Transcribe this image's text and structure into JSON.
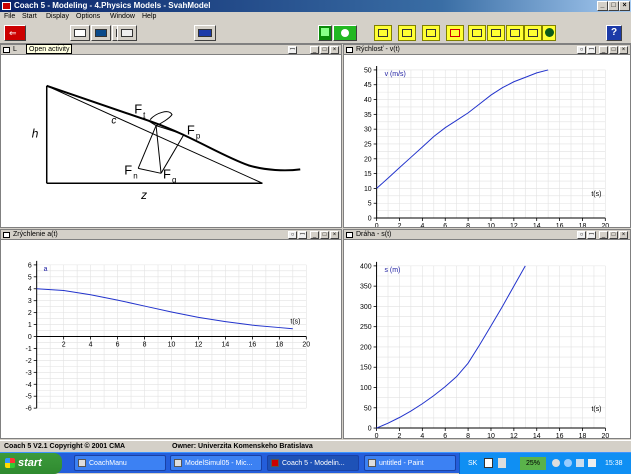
{
  "window": {
    "title": "Coach 5 - Modeling - 4.Physics Models - SvahModel"
  },
  "menu": [
    "File",
    "Start",
    "Display",
    "Options",
    "Window",
    "Help"
  ],
  "tooltip": "Open activity",
  "panels": {
    "diagram": {
      "title": "L",
      "labels": {
        "ft": "F",
        "ft_sub": "t",
        "fp": "F",
        "fp_sub": "p",
        "fn": "F",
        "fn_sub": "n",
        "fg": "F",
        "fg_sub": "g",
        "h": "h",
        "c": "c",
        "z": "z"
      }
    },
    "speed": {
      "title": "Rýchlosť - v(t)"
    },
    "accel": {
      "title": "Zrýchlenie a(t)"
    },
    "path": {
      "title": "Dráha - s(t)"
    }
  },
  "status": {
    "left": "Coach 5 V2.1 Copyright © 2001 CMA",
    "right": "Owner: Univerzita Komenskeho Bratislava"
  },
  "taskbar": {
    "start": "start",
    "tasks": [
      "CoachManu",
      "ModelSimul05 - Mic...",
      "Coach 5 - Modelin...",
      "untitled - Paint"
    ],
    "lang": "SK",
    "percent": "25%",
    "clock": "15:38"
  },
  "chart_data": [
    {
      "type": "line",
      "title": "Rýchlosť - v(t)",
      "ylabel": "v (m/s)",
      "xlabel": "t(s)",
      "xlim": [
        0,
        20
      ],
      "ylim": [
        0,
        50
      ],
      "xticks": [
        0,
        2,
        4,
        6,
        8,
        10,
        12,
        14,
        16,
        18,
        20
      ],
      "yticks": [
        0,
        5,
        10,
        15,
        20,
        25,
        30,
        35,
        40,
        45,
        50
      ],
      "series": [
        {
          "x": [
            0,
            1,
            2,
            3,
            4,
            5,
            6,
            7,
            8,
            9,
            10,
            11,
            12,
            13,
            14,
            15
          ],
          "y": [
            10,
            13.5,
            17,
            20.5,
            24,
            27.5,
            30.5,
            33,
            35.5,
            38.5,
            41.5,
            44,
            46,
            47.5,
            49,
            50
          ]
        }
      ]
    },
    {
      "type": "line",
      "title": "Zrýchlenie a(t)",
      "ylabel": "a",
      "xlabel": "t(s)",
      "xlim": [
        0,
        20
      ],
      "ylim": [
        -6,
        6
      ],
      "xticks": [
        2,
        4,
        6,
        8,
        10,
        12,
        14,
        16,
        18,
        20
      ],
      "yticks": [
        -6,
        -5,
        -4,
        -3,
        -2,
        -1,
        0,
        1,
        2,
        3,
        4,
        5,
        6
      ],
      "series": [
        {
          "x": [
            0,
            2,
            4,
            6,
            8,
            10,
            12,
            14,
            16,
            18,
            19
          ],
          "y": [
            4.0,
            3.85,
            3.5,
            3.05,
            2.55,
            2.05,
            1.6,
            1.25,
            0.95,
            0.75,
            0.65
          ]
        }
      ]
    },
    {
      "type": "line",
      "title": "Dráha - s(t)",
      "ylabel": "s (m)",
      "xlabel": "t(s)",
      "xlim": [
        0,
        20
      ],
      "ylim": [
        0,
        400
      ],
      "xticks": [
        0,
        2,
        4,
        6,
        8,
        10,
        12,
        14,
        16,
        18,
        20
      ],
      "yticks": [
        0,
        50,
        100,
        150,
        200,
        250,
        300,
        350,
        400
      ],
      "series": [
        {
          "x": [
            0,
            1,
            2,
            3,
            4,
            5,
            6,
            7,
            8,
            9,
            10,
            11,
            12,
            13
          ],
          "y": [
            0,
            12,
            26,
            42,
            60,
            80,
            102,
            127,
            160,
            205,
            252,
            300,
            350,
            400
          ]
        }
      ]
    }
  ]
}
